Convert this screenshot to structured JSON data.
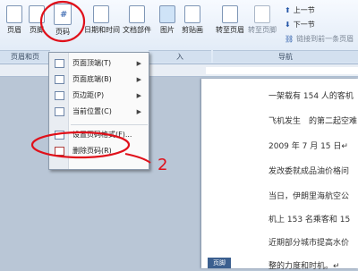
{
  "ribbon": {
    "buttons": [
      {
        "id": "header",
        "label": "页眉"
      },
      {
        "id": "footer",
        "label": "页脚"
      },
      {
        "id": "page_number",
        "label": "页码"
      },
      {
        "id": "date_time",
        "label": "日期和时间"
      },
      {
        "id": "doc_parts",
        "label": "文档部件"
      },
      {
        "id": "picture",
        "label": "图片"
      },
      {
        "id": "clip_art",
        "label": "剪贴画"
      },
      {
        "id": "goto_header",
        "label": "转至页眉"
      },
      {
        "id": "goto_footer",
        "label": "转至页脚"
      }
    ],
    "groups": {
      "header_footer": "页眉和页",
      "insert_a": "入",
      "navigation": "导航"
    },
    "nav": {
      "prev": "上一节",
      "next": "下一节",
      "link_previous": "链接到前一条页眉"
    }
  },
  "menu": {
    "items": [
      {
        "label": "页面顶端(T)",
        "submenu": true
      },
      {
        "label": "页面底端(B)",
        "submenu": true
      },
      {
        "label": "页边距(P)",
        "submenu": true
      },
      {
        "label": "当前位置(C)",
        "submenu": true
      },
      {
        "label": "设置页码格式(F)...",
        "submenu": false
      },
      {
        "label": "删除页码(R)",
        "submenu": false
      }
    ]
  },
  "document": {
    "lines": [
      "一架载有 154 人的客机",
      "飞机发生　的第二起空难",
      "2009 年 7 月 15 日↵",
      "发改委就成品油价格问",
      "当日，伊朗里海航空公",
      "机上 153 名乘客和 15",
      "近期部分城市提高水价",
      "整的力度和时机。↵"
    ],
    "page_tag": "页脚"
  },
  "annotations": {
    "mark": "2",
    "color": "#e0101a"
  }
}
